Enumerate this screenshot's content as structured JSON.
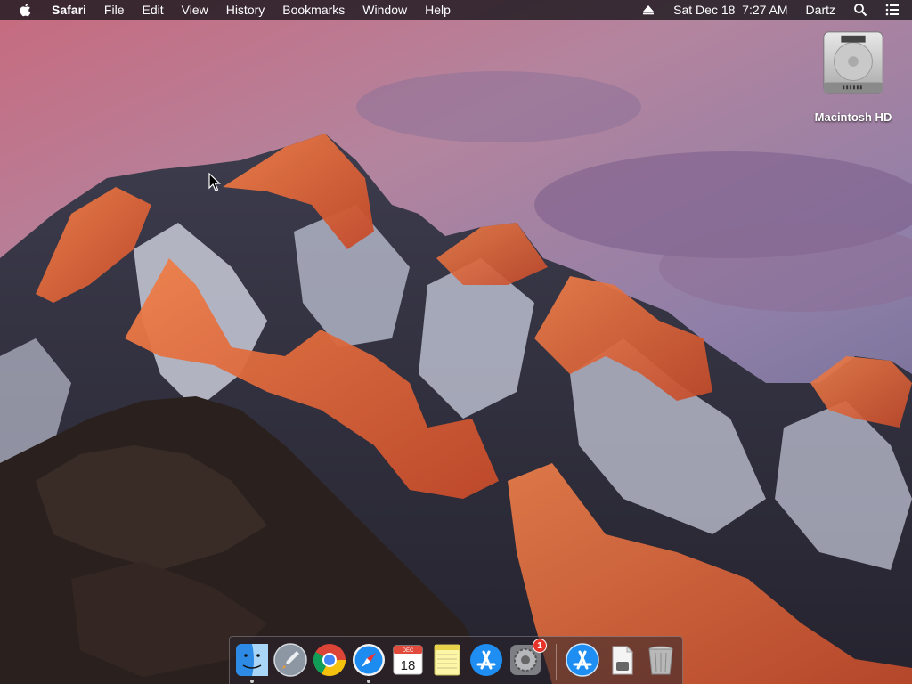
{
  "menubar": {
    "apple_icon": "apple-logo-icon",
    "app_name": "Safari",
    "items": [
      "File",
      "Edit",
      "View",
      "History",
      "Bookmarks",
      "Window",
      "Help"
    ],
    "airplay_icon": "airplay-icon",
    "clock": "Sat Dec 18  7:27 AM",
    "user": "Dartz",
    "spotlight_icon": "spotlight-search-icon",
    "notification_icon": "notification-center-icon"
  },
  "desktop": {
    "wallpaper": "macOS Sierra mountain wallpaper",
    "icons": [
      {
        "label": "Macintosh HD",
        "icon": "hard-drive-icon"
      }
    ]
  },
  "dock": {
    "items": [
      {
        "name": "Finder",
        "icon": "finder-icon",
        "running": true
      },
      {
        "name": "Launchpad",
        "icon": "launchpad-icon",
        "running": false
      },
      {
        "name": "Google Chrome",
        "icon": "chrome-icon",
        "running": false
      },
      {
        "name": "Safari",
        "icon": "safari-icon",
        "running": true
      },
      {
        "name": "Calendar",
        "icon": "calendar-icon",
        "running": false,
        "month": "DEC",
        "day": "18"
      },
      {
        "name": "Notes",
        "icon": "notes-icon",
        "running": false
      },
      {
        "name": "App Store",
        "icon": "app-store-icon",
        "running": false
      },
      {
        "name": "System Preferences",
        "icon": "system-preferences-icon",
        "running": false,
        "badge": "1"
      },
      {
        "name": "Applications",
        "icon": "app-store-folder-icon",
        "running": false
      },
      {
        "name": "Documents",
        "icon": "document-stack-icon",
        "running": false
      },
      {
        "name": "Trash",
        "icon": "trash-icon",
        "running": false
      }
    ]
  },
  "colors": {
    "menubar_bg": "#1c181e",
    "dock_badge": "#e8332b",
    "sky_top": "#c97b8e",
    "mountain_glow": "#e4683a"
  }
}
